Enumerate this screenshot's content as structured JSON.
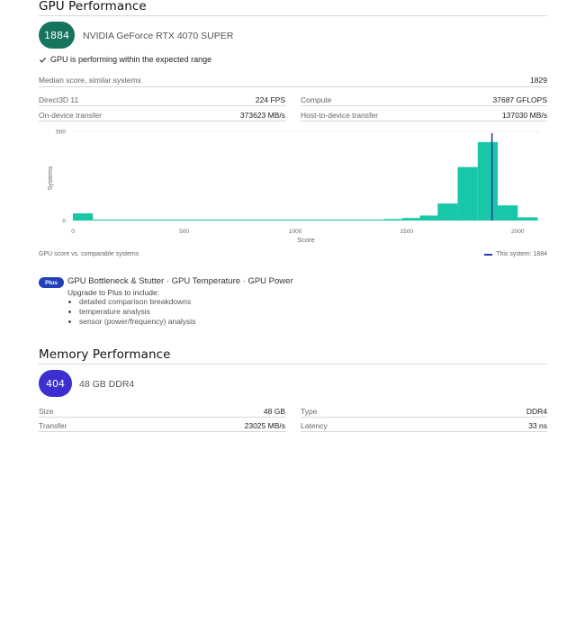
{
  "gpu": {
    "section_title": "GPU Performance",
    "score": "1884",
    "score_color": "#16735e",
    "device_name": "NVIDIA GeForce RTX 4070 SUPER",
    "status_text": "GPU is performing within the expected range",
    "median_label": "Median score, similar systems",
    "median_value": "1829",
    "stats": [
      {
        "label": "Direct3D 11",
        "value": "224 FPS"
      },
      {
        "label": "Compute",
        "value": "37687 GFLOPS"
      },
      {
        "label": "On-device transfer",
        "value": "373623 MB/s"
      },
      {
        "label": "Host-to-device transfer",
        "value": "137030 MB/s"
      }
    ]
  },
  "chart_data": {
    "type": "bar",
    "xlabel": "Score",
    "ylabel": "Systems",
    "xlim": [
      0,
      2100
    ],
    "ylim": [
      0,
      500
    ],
    "x_ticks": [
      "0",
      "500",
      "1000",
      "1500",
      "2000"
    ],
    "y_ticks": [
      "0",
      "500"
    ],
    "bar_color": "#17c7a7",
    "bins": [
      {
        "x0": 0,
        "x1": 90,
        "value": 40
      },
      {
        "x0": 90,
        "x1": 1400,
        "value": 3
      },
      {
        "x0": 1400,
        "x1": 1480,
        "value": 8
      },
      {
        "x0": 1480,
        "x1": 1560,
        "value": 14
      },
      {
        "x0": 1560,
        "x1": 1640,
        "value": 28
      },
      {
        "x0": 1640,
        "x1": 1730,
        "value": 95
      },
      {
        "x0": 1730,
        "x1": 1820,
        "value": 300
      },
      {
        "x0": 1820,
        "x1": 1910,
        "value": 440
      },
      {
        "x0": 1910,
        "x1": 2000,
        "value": 85
      },
      {
        "x0": 2000,
        "x1": 2090,
        "value": 18
      }
    ],
    "marker": {
      "value": 1884,
      "label": "This system: 1884",
      "color": "#2d3aa8"
    },
    "caption": "GPU score vs. comparable systems"
  },
  "plus": {
    "badge": "Plus",
    "title": "GPU Bottleneck & Stutter · GPU Temperature · GPU Power",
    "subtitle": "Upgrade to Plus to include:",
    "items": [
      "detailed comparison breakdowns",
      "temperature analysis",
      "sensor (power/frequency) analysis"
    ]
  },
  "memory": {
    "section_title": "Memory Performance",
    "score": "404",
    "score_color": "#3b2fcf",
    "device_name": "48 GB DDR4",
    "stats": [
      {
        "label": "Size",
        "value": "48 GB"
      },
      {
        "label": "Type",
        "value": "DDR4"
      },
      {
        "label": "Transfer",
        "value": "23025 MB/s"
      },
      {
        "label": "Latency",
        "value": "33 ns"
      }
    ]
  }
}
